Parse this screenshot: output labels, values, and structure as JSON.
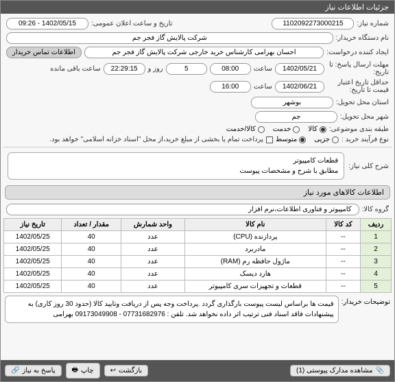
{
  "window": {
    "title": "جزئیات اطلاعات نیاز"
  },
  "header": {
    "need_no_label": "شماره نیاز:",
    "need_no": "1102092273000215",
    "announce_label": "تاریخ و ساعت اعلان عمومی:",
    "announce_value": "1402/05/15 - 09:26",
    "buyer_label": "نام دستگاه خریدار:",
    "buyer_value": "شرکت پالایش گاز فجر جم",
    "creator_label": "ایجاد کننده درخواست:",
    "creator_value": "احسان بهرامی کارشناس خرید خارجی شرکت پالایش گاز فجر جم",
    "contact_btn": "اطلاعات تماس خریدار",
    "deadline_label": "مهلت ارسال پاسخ: تا تاریخ:",
    "deadline_date": "1402/05/21",
    "time_lbl": "ساعت",
    "deadline_time": "08:00",
    "day_lbl": "روز و",
    "days_left": "5",
    "remain_time": "22:29:15",
    "remain_lbl": "ساعت باقی مانده",
    "validity_label": "حداقل تاریخ اعتبار قیمت تا تاریخ:",
    "validity_date": "1402/06/21",
    "validity_time": "16:00",
    "province_label": "استان محل تحویل:",
    "province_value": "بوشهر",
    "city_label": "شهر محل تحویل:",
    "city_value": "جم",
    "category_label": "طبقه بندی موضوعی:",
    "cat_goods": "کالا",
    "cat_service": "خدمت",
    "cat_goods_service": "کالا/خدمت",
    "buy_type_label": "نوع فرآیند خرید :",
    "buy_small": "جزیی",
    "buy_medium": "متوسط",
    "pay_note": "پرداخت تمام یا بخشی از مبلغ خرید،از محل \"اسناد خزانه اسلامی\" خواهد بود.",
    "need_title_label": "شرح کلی نیاز:",
    "need_title_l1": "قطعات کامپیوتر",
    "need_title_l2": "مطابق با شرح و مشخصات پیوست"
  },
  "items_section_title": "اطلاعات کالاهای مورد نیاز",
  "group_label": "گروه کالا:",
  "group_value": "کامپیوتر و فناوری اطلاعات،نرم افزار",
  "cols": {
    "idx": "ردیف",
    "code": "کد کالا",
    "name": "نام کالا",
    "unit": "واحد شمارش",
    "qty": "مقدار / تعداد",
    "date": "تاریخ نیاز"
  },
  "rows": [
    {
      "idx": "1",
      "code": "--",
      "name": "پردازنده (CPU)",
      "unit": "عدد",
      "qty": "40",
      "date": "1402/05/25"
    },
    {
      "idx": "2",
      "code": "--",
      "name": "مادربرد",
      "unit": "عدد",
      "qty": "40",
      "date": "1402/05/25"
    },
    {
      "idx": "3",
      "code": "--",
      "name": "ماژول حافظه رم (RAM)",
      "unit": "عدد",
      "qty": "40",
      "date": "1402/05/25"
    },
    {
      "idx": "4",
      "code": "--",
      "name": "هارد دیسک",
      "unit": "عدد",
      "qty": "40",
      "date": "1402/05/25"
    },
    {
      "idx": "5",
      "code": "--",
      "name": "قطعات و تجهیزات سری کامپیوتر",
      "unit": "عدد",
      "qty": "40",
      "date": "1402/05/25"
    }
  ],
  "buyer_notes_label": "توضیحات خریدار:",
  "buyer_notes": "قیمت ها براساس لیست پیوست بارگذاری گردد .پرداخت وجه پس از دریافت وتایید کالا (حدود 30 روز کاری)\nبه پیشنهادات فاقد اسناد فنی ترتیب اثر داده نخواهد شد. تلفن : 07731682976 - 09173049908 بهرامی",
  "footer": {
    "attachments": "مشاهده مدارک پیوستی (1)",
    "back": "بازگشت",
    "print": "چاپ",
    "link": "پاسخ به نیاز"
  }
}
